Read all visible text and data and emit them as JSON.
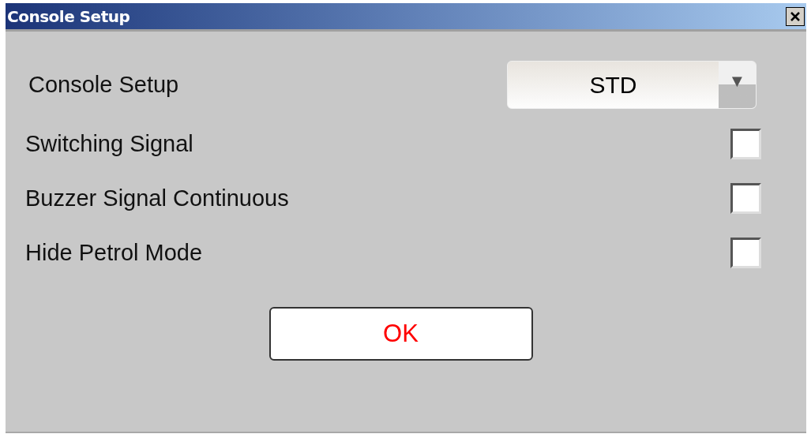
{
  "window": {
    "title": "Console Setup"
  },
  "setup": {
    "label": "Console Setup",
    "dropdown": {
      "value": "STD",
      "arrow": "▼"
    }
  },
  "options": [
    {
      "label": "Switching Signal",
      "checked": false
    },
    {
      "label": "Buzzer Signal Continuous",
      "checked": false
    },
    {
      "label": "Hide Petrol Mode",
      "checked": false
    }
  ],
  "buttons": [
    "OK"
  ]
}
